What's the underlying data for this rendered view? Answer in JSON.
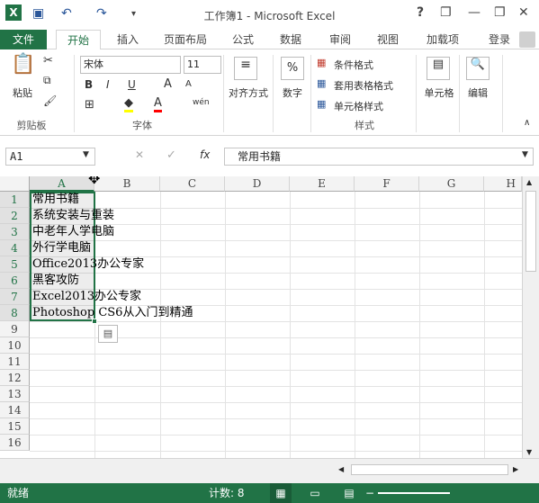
{
  "window": {
    "title": "工作簿1 - Microsoft Excel",
    "help": "?",
    "minimize": "—",
    "restore": "❐",
    "close": "✕"
  },
  "qat": {
    "save": "💾",
    "undo": "↶",
    "redo": "↷",
    "customize": "▾"
  },
  "tabs": {
    "file": "文件",
    "home": "开始",
    "insert": "插入",
    "layout": "页面布局",
    "formulas": "公式",
    "data": "数据",
    "review": "审阅",
    "view": "视图",
    "addins": "加载项",
    "login": "登录"
  },
  "ribbon": {
    "clipboard": {
      "paste": "粘贴",
      "group": "剪贴板"
    },
    "font": {
      "name": "宋体",
      "size": "11",
      "bold": "B",
      "italic": "I",
      "underline": "U",
      "grow": "A",
      "shrink": "A",
      "group": "字体"
    },
    "alignment": {
      "label": "对齐方式"
    },
    "number": {
      "symbol": "%",
      "label": "数字"
    },
    "styles": {
      "conditional": "条件格式",
      "table": "套用表格格式",
      "cell": "单元格样式",
      "group": "样式"
    },
    "cells": {
      "label": "单元格"
    },
    "editing": {
      "label": "编辑"
    }
  },
  "formula_bar": {
    "name_box": "A1",
    "value": "常用书籍",
    "fx": "fx",
    "cancel": "✕",
    "enter": "✓"
  },
  "sheet": {
    "columns": [
      "A",
      "B",
      "C",
      "D",
      "E",
      "F",
      "G",
      "H"
    ],
    "rows": [
      "1",
      "2",
      "3",
      "4",
      "5",
      "6",
      "7",
      "8",
      "9",
      "10",
      "11",
      "12",
      "13",
      "14",
      "15",
      "16"
    ],
    "cells": [
      "常用书籍",
      "系统安装与重装",
      "中老年人学电脑",
      "外行学电脑",
      "Office2013办公专家",
      "黑客攻防",
      "Excel2013办公专家",
      "Photoshop CS6从入门到精通"
    ]
  },
  "status": {
    "ready": "就绪",
    "count_label": "计数: 8"
  }
}
